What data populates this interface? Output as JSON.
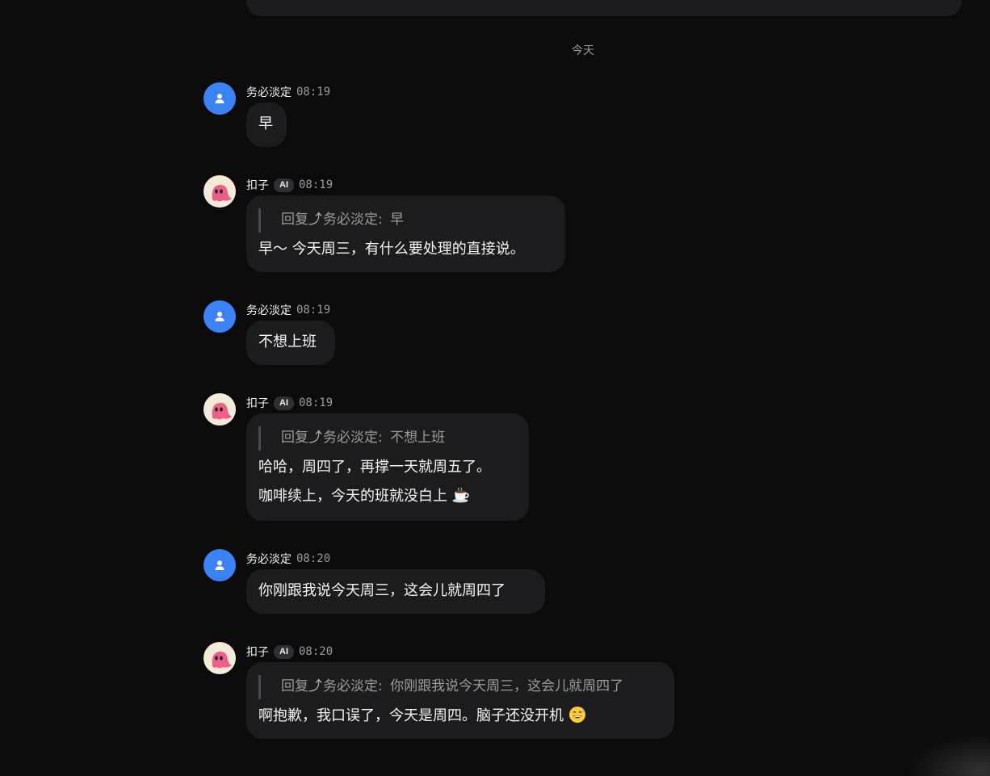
{
  "date_divider": "今天",
  "user": {
    "name": "务必淡定",
    "avatar_icon": "person-icon",
    "avatar_color": "#3b82f6"
  },
  "bot": {
    "name": "扣子",
    "badge": "AI",
    "avatar_icon": "pink-ghost-icon",
    "avatar_color": "#f4ead7"
  },
  "reply_label": "回复",
  "reply_arrow": "⤴",
  "messages": [
    {
      "sender": "务必淡定",
      "time": "08:19",
      "text": "早"
    },
    {
      "sender": "扣子",
      "badge": "AI",
      "time": "08:19",
      "quote": {
        "label": "回复",
        "arrow": "⤴",
        "to": "务必淡定:",
        "text": "早"
      },
      "lines": [
        "早～ 今天周三，有什么要处理的直接说。"
      ]
    },
    {
      "sender": "务必淡定",
      "time": "08:19",
      "text": "不想上班"
    },
    {
      "sender": "扣子",
      "badge": "AI",
      "time": "08:19",
      "quote": {
        "label": "回复",
        "arrow": "⤴",
        "to": "务必淡定:",
        "text": "不想上班"
      },
      "lines": [
        "哈哈，周四了，再撑一天就周五了。",
        "咖啡续上，今天的班就没白上"
      ],
      "emoji": "coffee-cup-icon"
    },
    {
      "sender": "务必淡定",
      "time": "08:20",
      "text": "你刚跟我说今天周三，这会儿就周四了"
    },
    {
      "sender": "扣子",
      "badge": "AI",
      "time": "08:20",
      "quote": {
        "label": "回复",
        "arrow": "⤴",
        "to": "务必淡定:",
        "text": "你刚跟我说今天周三，这会儿就周四了"
      },
      "lines": [
        "啊抱歉，我口误了，今天是周四。脑子还没开机"
      ],
      "emoji": "grinning-sweat-face-icon"
    }
  ]
}
